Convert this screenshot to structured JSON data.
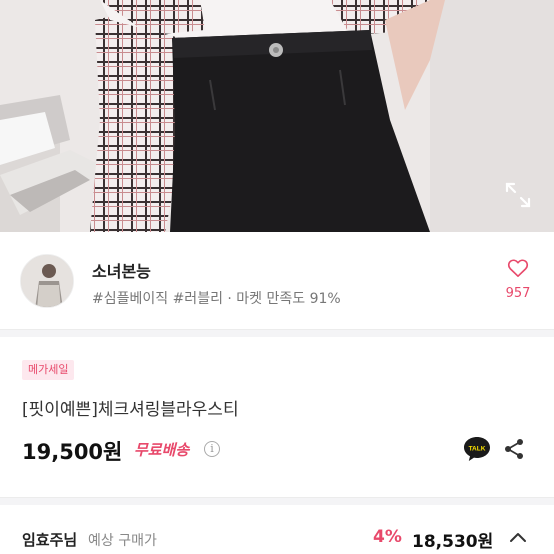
{
  "shop": {
    "name": "소녀본능",
    "tags": "#심플베이직 #러블리 · 마켓 만족도 91%",
    "likes": "957"
  },
  "product": {
    "badge": "메가세일",
    "title": "[핏이예쁜]체크셔링블라우스티",
    "price": "19,500원",
    "shipping": "무료배송",
    "info_symbol": "i",
    "talk_label": "TALK"
  },
  "expected": {
    "buyer": "임효주님",
    "label": "예상 구매가",
    "discount": "4%",
    "price": "18,530원"
  },
  "colors": {
    "accent": "#e8496b",
    "badge_bg": "#fde8ee",
    "kakao_yellow": "#f9e000"
  }
}
